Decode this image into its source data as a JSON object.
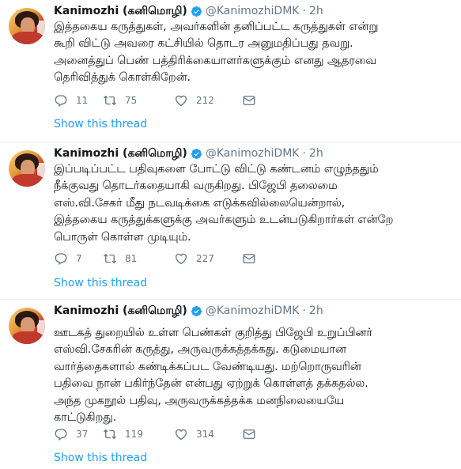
{
  "tweets": [
    {
      "name": "Kanimozhi (கனிமொழி)",
      "handle": "@KanimozhiDMK",
      "separator": "·",
      "time": "2h",
      "lines": [
        "இத்தகைய கருத்துகள், அவர்களின் தனிப்பட்ட கருத்துகள் என்று",
        "கூறி விட்டு அவரை கட்சியில் தொடர அனுமதிப்பது தவறு.",
        "அனைத்துப் பெண் பத்திரிக்கையாளர்களுக்கும் எனது ஆதரவை",
        "தெரிவித்துக் கொள்கிறேன்."
      ],
      "replies": "11",
      "retweets": "75",
      "likes": "212",
      "show_thread": "Show this thread"
    },
    {
      "name": "Kanimozhi (கனிமொழி)",
      "handle": "@KanimozhiDMK",
      "separator": "·",
      "time": "2h",
      "lines": [
        "இப்படிப்பட்ட பதிவுகளை போட்டு விட்டு கண்டனம் எழுந்ததும்",
        "நீக்குவது தொடர்கதையாகி வருகிறது. பிஜேபி தலைமை",
        "எஸ்.வி.சேகர் மீது நடவடிக்கை எடுக்கவில்லையென்றால்,",
        "இத்தகைய கருத்துக்களுக்கு அவர்களும் உடன்படுகிறார்கள் என்றே",
        "பொருள் கொள்ள முடியும்."
      ],
      "replies": "7",
      "retweets": "81",
      "likes": "227",
      "show_thread": "Show this thread"
    },
    {
      "name": "Kanimozhi (கனிமொழி)",
      "handle": "@KanimozhiDMK",
      "separator": "·",
      "time": "2h",
      "lines": [
        "ஊடகத் துறையில் உள்ள பெண்கள் குறித்து பிஜேபி உறுப்பினர்",
        "எஸ்வி.சேகரின் கருத்து, அருவருக்கத்தக்கது. கடுமையான",
        "வார்த்தைகளால் கண்டிக்கப்பட வேண்டியது. மற்றொருவரின்",
        "பதிவை நான் பகிர்ந்தேன் என்பது ஏற்றுக் கொள்ளத் தக்கதல்ல.",
        "அந்த முகநூல் பதிவு, அருவருக்கத்தக்க மனநிலையையே",
        "காட்டுகிறது."
      ],
      "replies": "37",
      "retweets": "119",
      "likes": "314",
      "show_thread": "Show this thread"
    }
  ],
  "colors": {
    "accent": "#1da1f2",
    "muted": "#657786",
    "text": "#14171a",
    "divider": "#e6ecf0"
  },
  "icons": [
    "verified-badge-icon",
    "reply-icon",
    "retweet-icon",
    "like-icon",
    "direct-message-icon"
  ]
}
